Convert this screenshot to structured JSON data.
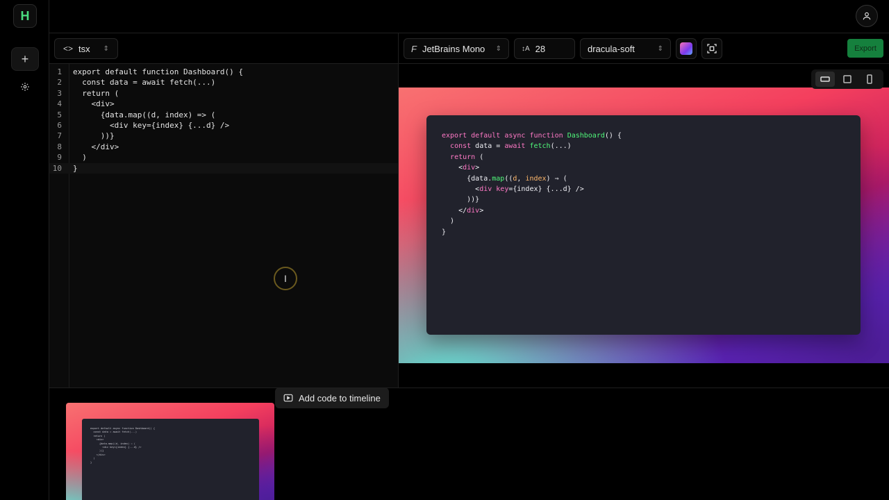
{
  "app": {
    "logo_letter": "H"
  },
  "editor": {
    "language": "tsx",
    "lines": [
      "export default function Dashboard() {",
      "  const data = await fetch(...)",
      "  return (",
      "    <div>",
      "      {data.map((d, index) => (",
      "        <div key={index} {...d} />",
      "      ))}",
      "    </div>",
      "  )",
      "}"
    ],
    "line_numbers": [
      "1",
      "2",
      "3",
      "4",
      "5",
      "6",
      "7",
      "8",
      "9",
      "10"
    ],
    "active_line": 10,
    "add_timeline_label": "Add code to timeline"
  },
  "toolbar": {
    "font": "JetBrains Mono",
    "font_size": "28",
    "theme": "dracula-soft",
    "export_label": "Export"
  },
  "preview": {
    "code_lines": [
      "export default async function Dashboard() {",
      "  const data = await fetch(...)",
      "  return (",
      "    <div>",
      "      {data.map((d, index) ⇒ (",
      "        <div key={index} {...d} />",
      "      ))}",
      "    </div>",
      "  )",
      "}"
    ]
  },
  "colors": {
    "accent_green": "#15803d",
    "logo_green": "#4ade80",
    "code_window_bg": "#21222c",
    "keyword_pink": "#ff79c6",
    "function_green": "#50fa7b",
    "param_orange": "#ffb86c"
  },
  "icons": [
    "code-icon",
    "plus-icon",
    "gear-icon",
    "user-icon",
    "font-icon",
    "font-size-icon",
    "background-swatch-icon",
    "frame-icon",
    "text-cursor-icon",
    "video-icon",
    "landscape-view-icon",
    "square-view-icon",
    "portrait-view-icon"
  ]
}
